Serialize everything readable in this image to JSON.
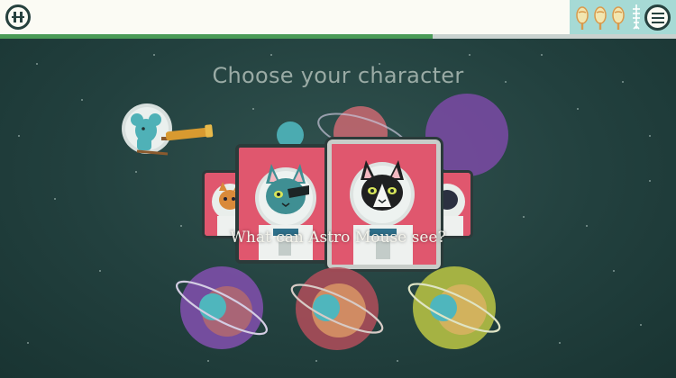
{
  "header": {
    "pause_icon": "pause-icon",
    "menu_icon": "menu-icon",
    "progress": 0.64,
    "treats": {
      "earned": 3,
      "remaining": 1,
      "icons": [
        "ice-pop-icon",
        "ice-pop-icon",
        "ice-pop-icon",
        "fishbone-icon"
      ]
    }
  },
  "scene": {
    "title": "Choose your character",
    "prompt": "What can Astro Mouse see?"
  },
  "characters": [
    {
      "name": "orange-cat",
      "icon": "orange-cat-icon"
    },
    {
      "name": "teal-cat-eyepatch",
      "icon": "teal-cat-icon"
    },
    {
      "name": "black-white-cat",
      "icon": "black-cat-icon",
      "selected": true
    },
    {
      "name": "dog",
      "icon": "dog-icon"
    }
  ],
  "answer_options": [
    {
      "name": "purple-planet",
      "color": "#7d4fa8"
    },
    {
      "name": "red-planet",
      "color": "#b24e5a"
    },
    {
      "name": "green-planet",
      "color": "#b4bf44"
    }
  ],
  "colors": {
    "background": "#22403e",
    "card": "#e0576e",
    "accent": "#4a9b57",
    "title": "#9aaba5"
  }
}
